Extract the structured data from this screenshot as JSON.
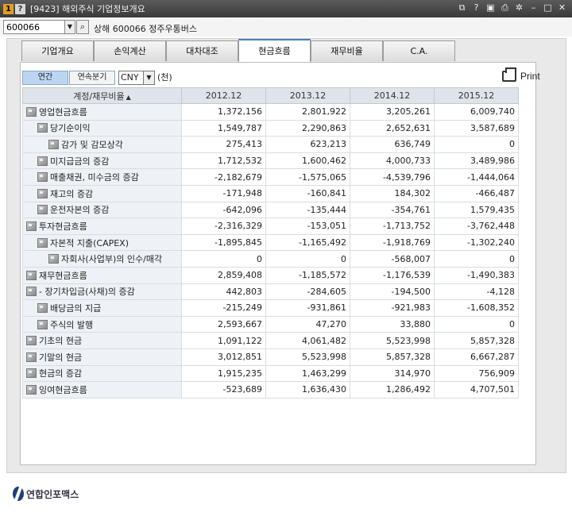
{
  "window": {
    "badge_number": "1",
    "badge_help": "?",
    "title": "[9423] 해외주식 기업정보개요"
  },
  "toolbar_icons": [
    "link-icon",
    "help-icon",
    "save-icon",
    "print-icon",
    "settings-icon",
    "minimize-icon",
    "maximize-icon",
    "close-icon"
  ],
  "code_row": {
    "code_value": "600066",
    "company": "상해 600066 정주우통버스"
  },
  "tabs": [
    {
      "label": "기업개요"
    },
    {
      "label": "손익계산"
    },
    {
      "label": "대차대조"
    },
    {
      "label": "현금흐름",
      "active": true
    },
    {
      "label": "재무비율"
    },
    {
      "label": "C.A."
    }
  ],
  "controls": {
    "annual": "연간",
    "quarterly": "연속분기",
    "currency": "CNY",
    "unit": "(천)",
    "print": "Print"
  },
  "table": {
    "header_account": "계정/재무비율",
    "periods": [
      "2012.12",
      "2013.12",
      "2014.12",
      "2015.12"
    ],
    "rows": [
      {
        "label": "영업현금흐름",
        "indent": 0,
        "values": [
          "1,372,156",
          "2,801,922",
          "3,205,261",
          "6,009,740"
        ]
      },
      {
        "label": "당기순이익",
        "indent": 1,
        "values": [
          "1,549,787",
          "2,290,863",
          "2,652,631",
          "3,587,689"
        ]
      },
      {
        "label": "감가 및 감모상각",
        "indent": 2,
        "values": [
          "275,413",
          "623,213",
          "636,749",
          "0"
        ]
      },
      {
        "label": "미지급금의 증감",
        "indent": 1,
        "values": [
          "1,712,532",
          "1,600,462",
          "4,000,733",
          "3,489,986"
        ]
      },
      {
        "label": "매출채권, 미수금의 증감",
        "indent": 1,
        "values": [
          "-2,182,679",
          "-1,575,065",
          "-4,539,796",
          "-1,444,064"
        ]
      },
      {
        "label": "재고의 증감",
        "indent": 1,
        "values": [
          "-171,948",
          "-160,841",
          "184,302",
          "-466,487"
        ]
      },
      {
        "label": "운전자본의 증감",
        "indent": 1,
        "values": [
          "-642,096",
          "-135,444",
          "-354,761",
          "1,579,435"
        ]
      },
      {
        "label": "투자현금흐름",
        "indent": 0,
        "values": [
          "-2,316,329",
          "-153,051",
          "-1,713,752",
          "-3,762,448"
        ]
      },
      {
        "label": "자본적 지출(CAPEX)",
        "indent": 1,
        "values": [
          "-1,895,845",
          "-1,165,492",
          "-1,918,769",
          "-1,302,240"
        ]
      },
      {
        "label": "자회사(사업부)의 인수/매각",
        "indent": 2,
        "values": [
          "0",
          "0",
          "-568,007",
          "0"
        ]
      },
      {
        "label": "재무현금흐름",
        "indent": 0,
        "values": [
          "2,859,408",
          "-1,185,572",
          "-1,176,539",
          "-1,490,383"
        ]
      },
      {
        "label": "- 장기차입금(사채)의 증감",
        "indent": 0,
        "values": [
          "442,803",
          "-284,605",
          "-194,500",
          "-4,128"
        ]
      },
      {
        "label": "배당금의 지급",
        "indent": 1,
        "values": [
          "-215,249",
          "-931,861",
          "-921,983",
          "-1,608,352"
        ]
      },
      {
        "label": "주식의 발행",
        "indent": 1,
        "values": [
          "2,593,667",
          "47,270",
          "33,880",
          "0"
        ]
      },
      {
        "label": "기초의 현금",
        "indent": 0,
        "values": [
          "1,091,122",
          "4,061,482",
          "5,523,998",
          "5,857,328"
        ]
      },
      {
        "label": "기말의 현금",
        "indent": 0,
        "values": [
          "3,012,851",
          "5,523,998",
          "5,857,328",
          "6,667,287"
        ]
      },
      {
        "label": "현금의 증감",
        "indent": 0,
        "values": [
          "1,915,235",
          "1,463,299",
          "314,970",
          "756,909"
        ]
      },
      {
        "label": "잉여현금흐름",
        "indent": 0,
        "values": [
          "-523,689",
          "1,636,430",
          "1,286,492",
          "4,707,501"
        ]
      }
    ]
  },
  "footer": {
    "logo_text": "연합인포맥스"
  }
}
